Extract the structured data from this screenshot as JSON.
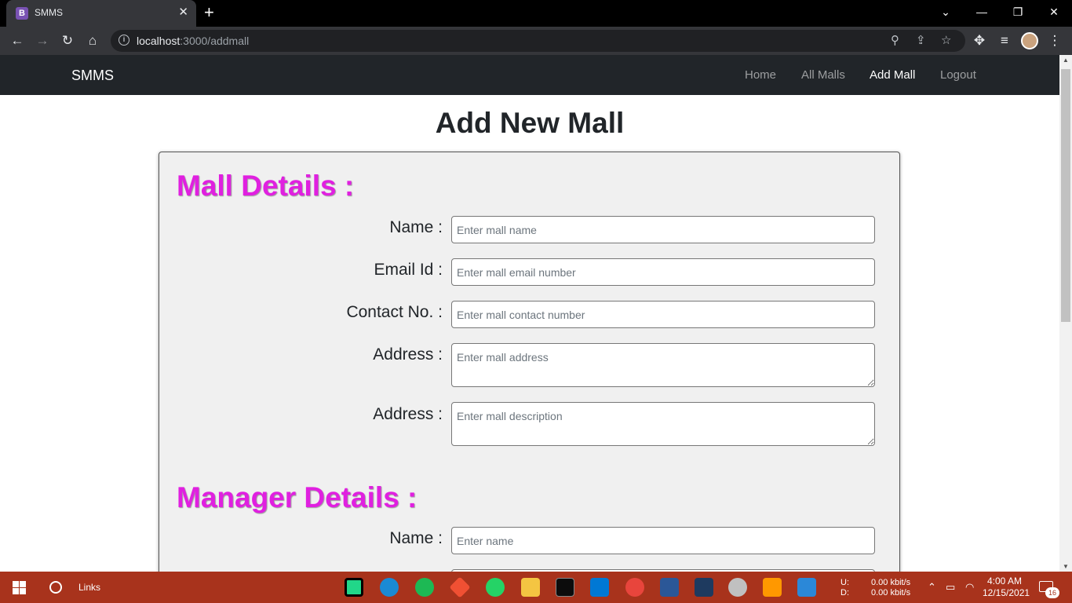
{
  "browser": {
    "tab_title": "SMMS",
    "tab_favicon": "B",
    "url_host": "localhost",
    "url_path": ":3000/addmall"
  },
  "navbar": {
    "brand": "SMMS",
    "links": [
      {
        "label": "Home",
        "active": false
      },
      {
        "label": "All Malls",
        "active": false
      },
      {
        "label": "Add Mall",
        "active": true
      },
      {
        "label": "Logout",
        "active": false
      }
    ]
  },
  "page": {
    "title": "Add New Mall"
  },
  "mall_details": {
    "heading": "Mall Details :",
    "fields": [
      {
        "label": "Name :",
        "placeholder": "Enter mall name"
      },
      {
        "label": "Email Id :",
        "placeholder": "Enter mall email number"
      },
      {
        "label": "Contact No. :",
        "placeholder": "Enter mall contact number"
      },
      {
        "label": "Address :",
        "placeholder": "Enter mall address"
      },
      {
        "label": "Address :",
        "placeholder": "Enter mall description"
      }
    ]
  },
  "manager_details": {
    "heading": "Manager Details :",
    "fields": [
      {
        "label": "Name :",
        "placeholder": "Enter name"
      }
    ]
  },
  "taskbar": {
    "search_label": "Links",
    "net_up_label": "U:",
    "net_down_label": "D:",
    "net_up": "0.00 kbit/s",
    "net_down": "0.00 kbit/s",
    "time": "4:00 AM",
    "date": "12/15/2021",
    "notification_count": "16"
  },
  "colors": {
    "section_heading": "#e020e0",
    "navbar_bg": "#212529",
    "taskbar_bg": "#a8331c"
  }
}
